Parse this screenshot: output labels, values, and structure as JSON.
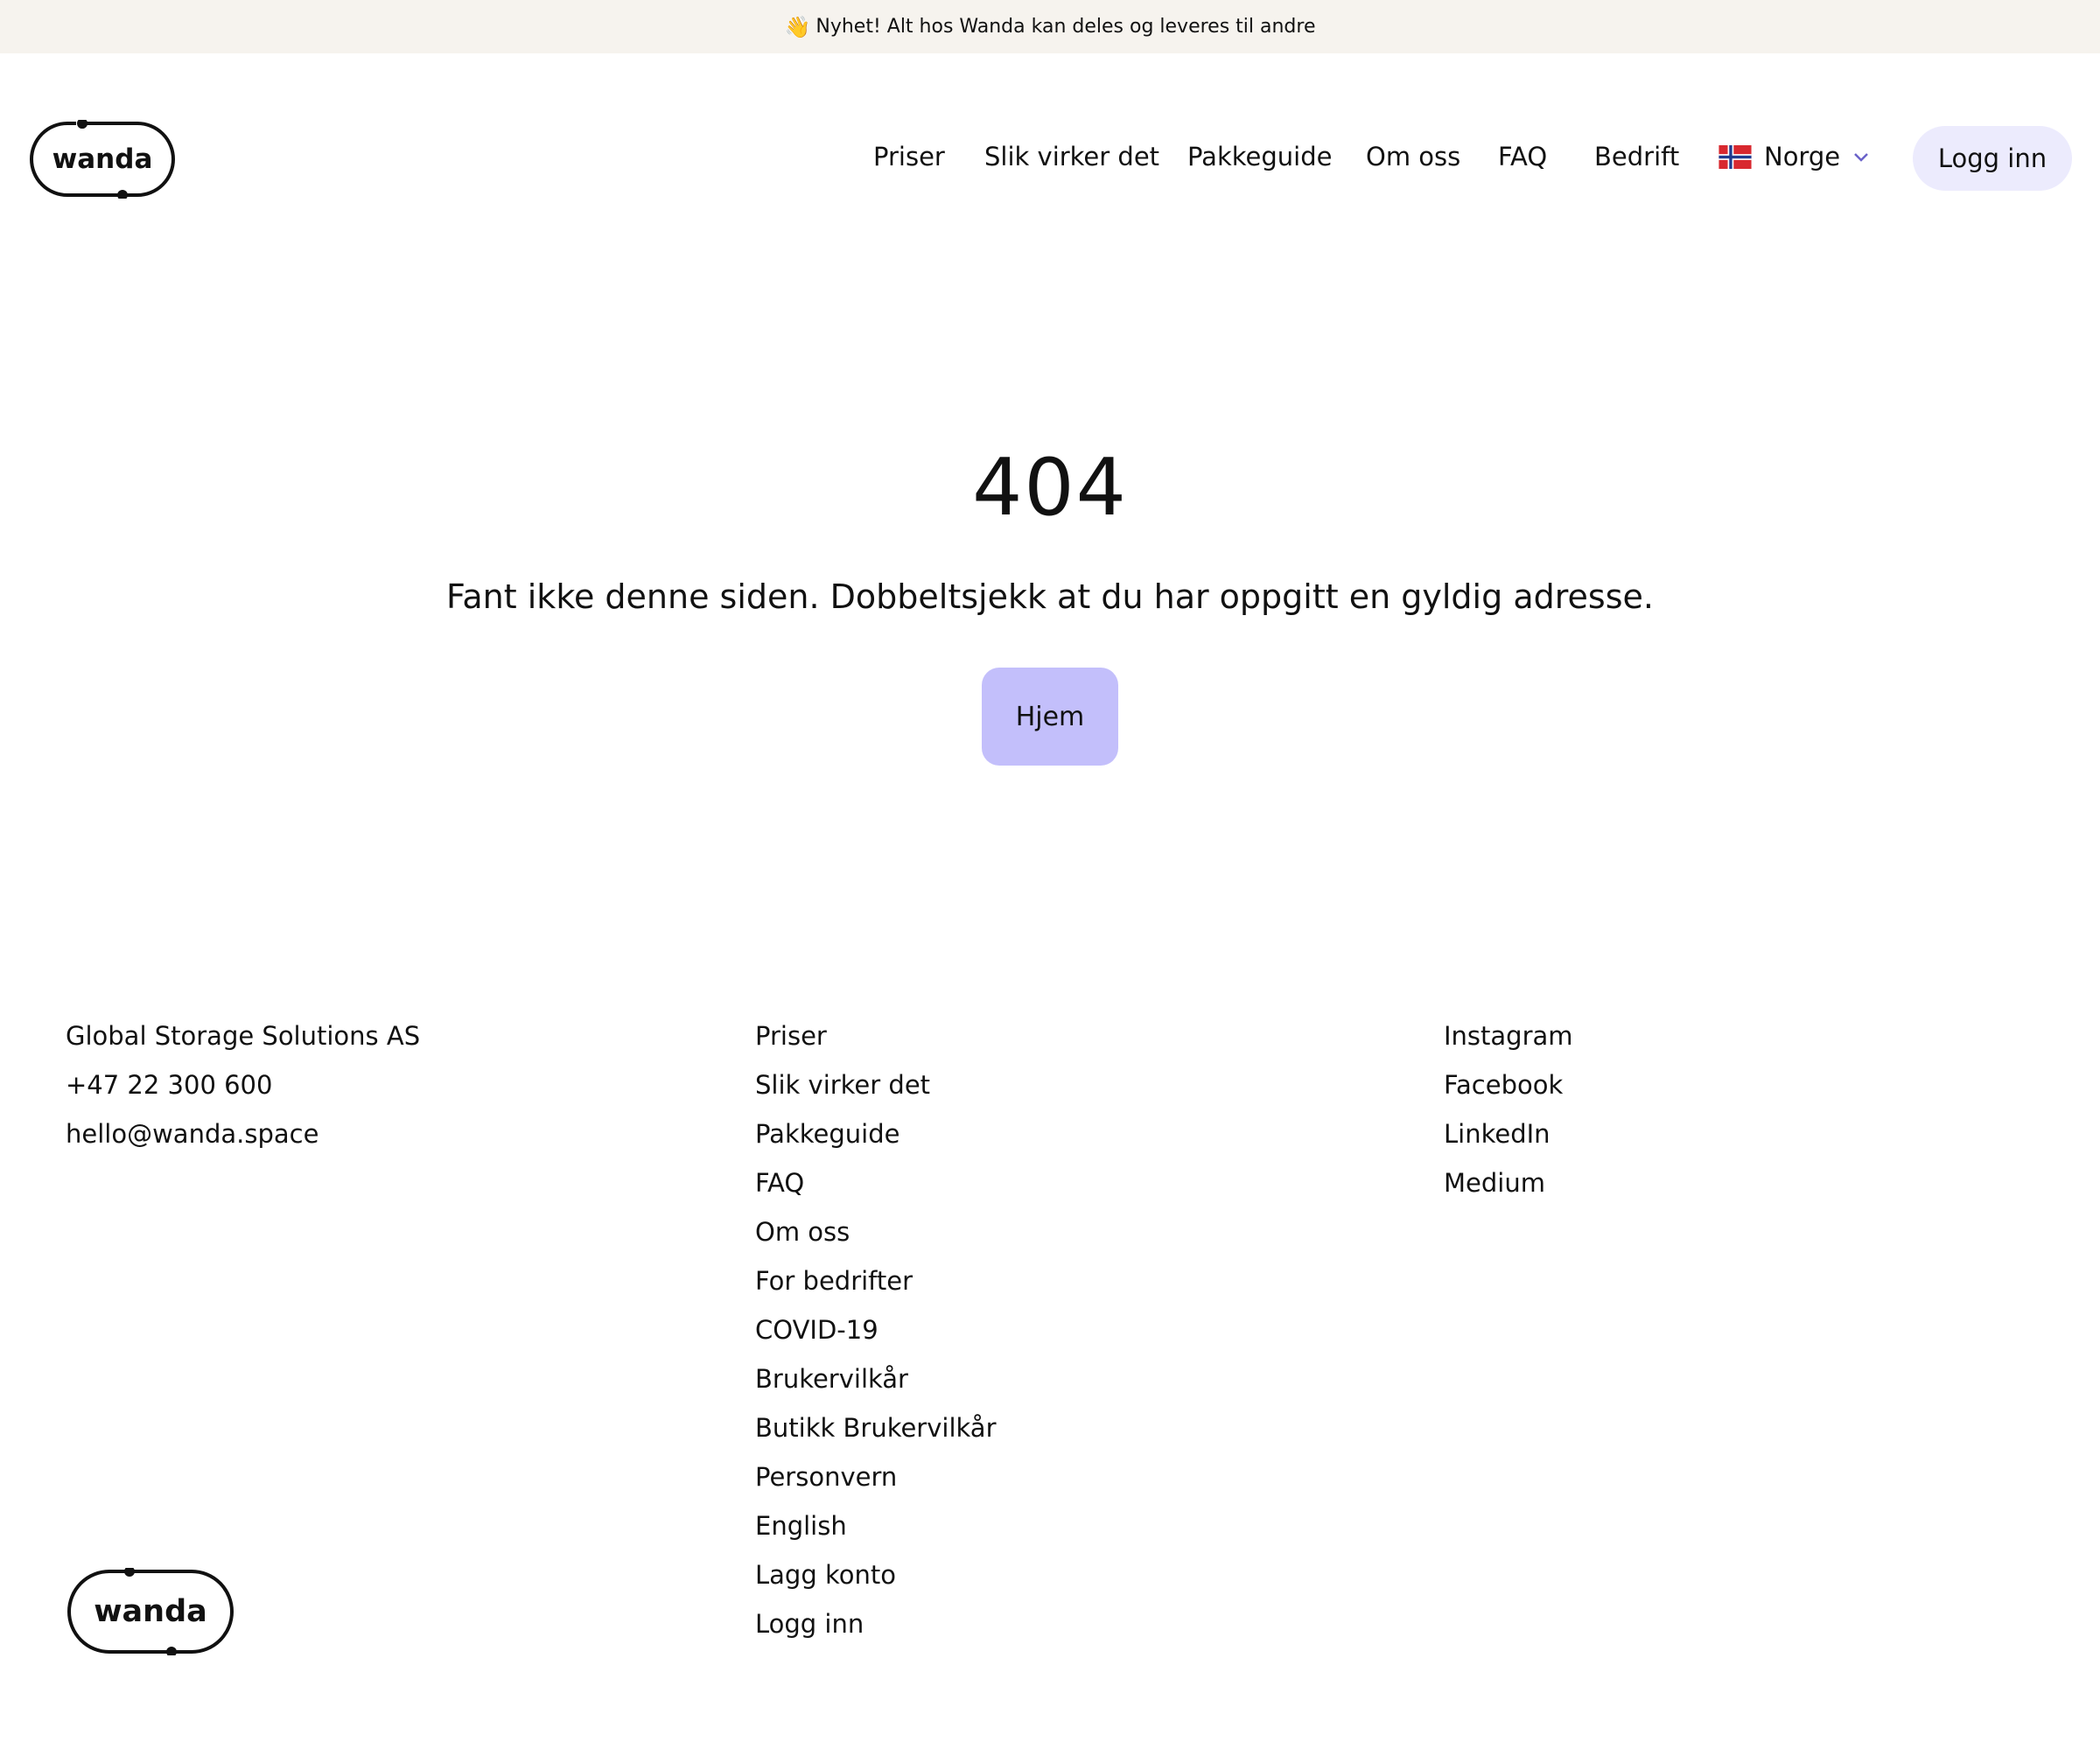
{
  "banner": {
    "emoji": "👋",
    "text": "Nyhet! Alt hos Wanda kan deles og leveres til andre"
  },
  "header": {
    "logo_text": "wanda",
    "nav": [
      "Priser",
      "Slik virker det",
      "Pakkeguide",
      "Om oss",
      "FAQ",
      "Bedrift"
    ],
    "country": "Norge",
    "login_label": "Logg inn"
  },
  "error": {
    "code": "404",
    "message": "Fant ikke denne siden. Dobbeltsjekk at du har oppgitt en gyldig adresse.",
    "home_label": "Hjem"
  },
  "footer": {
    "company": [
      "Global Storage Solutions AS",
      "+47 22 300 600",
      "hello@wanda.space"
    ],
    "links": [
      "Priser",
      "Slik virker det",
      "Pakkeguide",
      "FAQ",
      "Om oss",
      "For bedrifter",
      "COVID-19",
      "Brukervilkår",
      "Butikk Brukervilkår",
      "Personvern",
      "English",
      "Lagg konto",
      "Logg inn"
    ],
    "social": [
      "Instagram",
      "Facebook",
      "LinkedIn",
      "Medium"
    ],
    "logo_text": "wanda"
  },
  "colors": {
    "banner_bg": "#f6f3ee",
    "login_bg": "#ecebfd",
    "home_bg": "#c3bffb",
    "chevron": "#6a62c9"
  }
}
